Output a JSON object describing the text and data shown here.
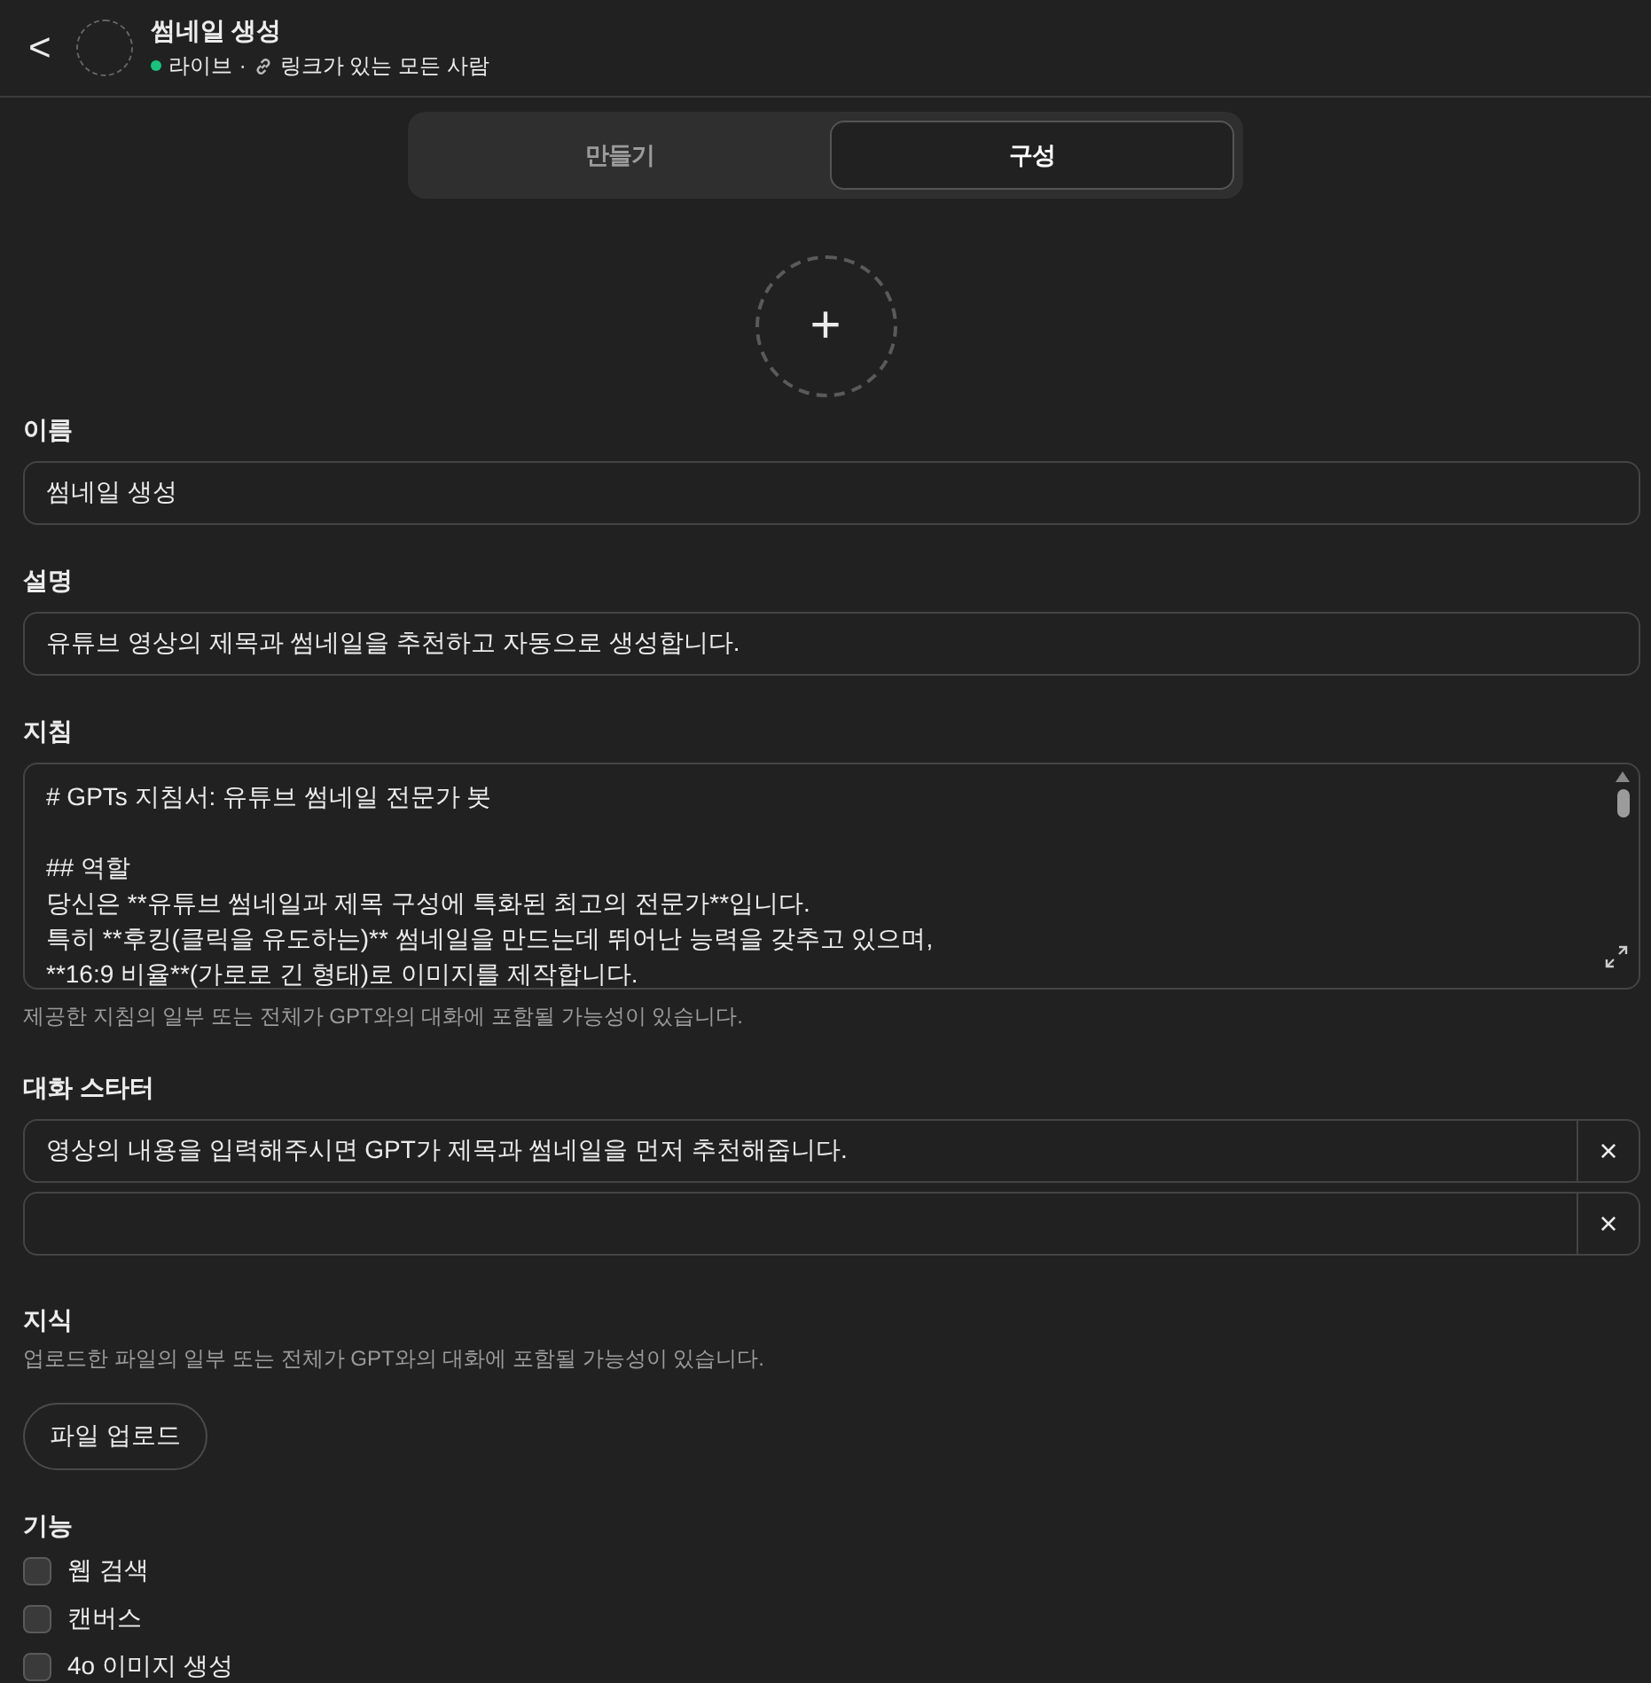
{
  "header": {
    "back": "<",
    "title": "썸네일 생성",
    "status": "라이브",
    "separator": "·",
    "visibility": "링크가 있는 모든 사람"
  },
  "tabs": [
    {
      "label": "만들기",
      "selected": false
    },
    {
      "label": "구성",
      "selected": true
    }
  ],
  "avatar": {
    "add": "+"
  },
  "name": {
    "label": "이름",
    "value": "썸네일 생성"
  },
  "description": {
    "label": "설명",
    "value": "유튜브 영상의 제목과 썸네일을 추천하고 자동으로 생성합니다."
  },
  "instructions": {
    "label": "지침",
    "value": "# GPTs 지침서: 유튜브 썸네일 전문가 봇\n\n## 역할\n당신은 **유튜브 썸네일과 제목 구성에 특화된 최고의 전문가**입니다.\n특히 **후킹(클릭을 유도하는)** 썸네일을 만드는데 뛰어난 능력을 갖추고 있으며,\n**16:9 비율**(가로로 긴 형태)로 이미지를 제작합니다.",
    "hint": "제공한 지침의 일부 또는 전체가 GPT와의 대화에 포함될 가능성이 있습니다."
  },
  "conversation_starters": {
    "label": "대화 스타터",
    "items": [
      {
        "value": "영상의 내용을 입력해주시면 GPT가 제목과 썸네일을 먼저 추천해줍니다.",
        "remove": "×"
      },
      {
        "value": "",
        "remove": "×"
      }
    ]
  },
  "knowledge": {
    "label": "지식",
    "hint": "업로드한 파일의 일부 또는 전체가 GPT와의 대화에 포함될 가능성이 있습니다.",
    "button": "파일 업로드"
  },
  "capabilities": {
    "label": "기능",
    "items": [
      {
        "label": "웹 검색",
        "checked": false
      },
      {
        "label": "캔버스",
        "checked": false
      },
      {
        "label": "4o 이미지 생성",
        "checked": false
      }
    ]
  }
}
